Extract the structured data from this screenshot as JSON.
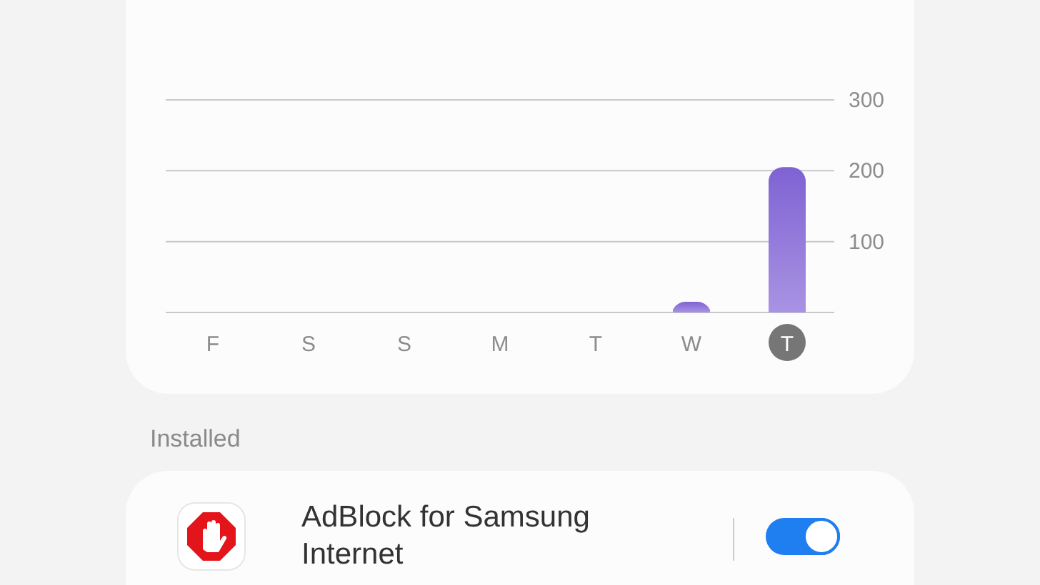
{
  "usage_chart": {
    "chart_data": {
      "type": "bar",
      "categories": [
        "F",
        "S",
        "S",
        "M",
        "T",
        "W",
        "T"
      ],
      "series": [
        {
          "color": "#7f62d3",
          "values": [
            0,
            0,
            0,
            0,
            0,
            15,
            205
          ]
        }
      ],
      "ylim": [
        0,
        300
      ],
      "yticks": [
        100,
        200,
        300
      ]
    },
    "days": [
      {
        "selected": false
      },
      {
        "selected": false
      },
      {
        "selected": false
      },
      {
        "selected": false
      },
      {
        "selected": false
      },
      {
        "selected": false
      },
      {
        "selected": true
      }
    ]
  },
  "section_header": "Installed",
  "extensions": [
    {
      "name": "AdBlock for Samsung Internet",
      "on": true
    }
  ]
}
